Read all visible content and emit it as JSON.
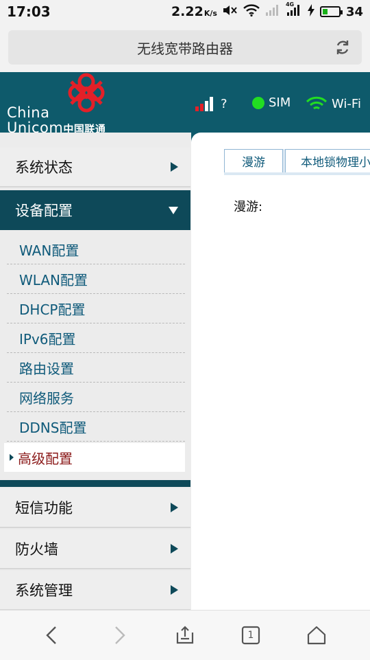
{
  "status_bar": {
    "time": "17:03",
    "speed": "2.22",
    "speed_unit": "K/s",
    "network_type": "4G",
    "battery_level": "34",
    "battery_fraction": 0.34
  },
  "browser": {
    "page_title": "无线宽带路由器"
  },
  "header": {
    "logo_text_line1": "China",
    "logo_text_line2": "Unicom",
    "logo_text_cn": "中国联通",
    "signal_status": "?",
    "sim_label": "SIM",
    "wifi_label": "Wi-Fi",
    "sim_color": "#22dd22",
    "wifi_color": "#22dd22",
    "brand_color": "#0e5a6b",
    "logo_color": "#e32028"
  },
  "sidebar": {
    "menu_top": [
      {
        "label": "系统状态"
      },
      {
        "label": "设备配置"
      }
    ],
    "submenu": [
      {
        "label": "WAN配置"
      },
      {
        "label": "WLAN配置"
      },
      {
        "label": "DHCP配置"
      },
      {
        "label": "IPv6配置"
      },
      {
        "label": "路由设置"
      },
      {
        "label": "网络服务"
      },
      {
        "label": "DDNS配置"
      },
      {
        "label": "高级配置"
      }
    ],
    "menu_bottom": [
      {
        "label": "短信功能"
      },
      {
        "label": "防火墙"
      },
      {
        "label": "系统管理"
      }
    ]
  },
  "content": {
    "tabs": [
      {
        "label": "漫游"
      },
      {
        "label": "本地锁物理小"
      }
    ],
    "roaming_label": "漫游:"
  },
  "bottom_nav": {
    "tab_count": "1"
  }
}
